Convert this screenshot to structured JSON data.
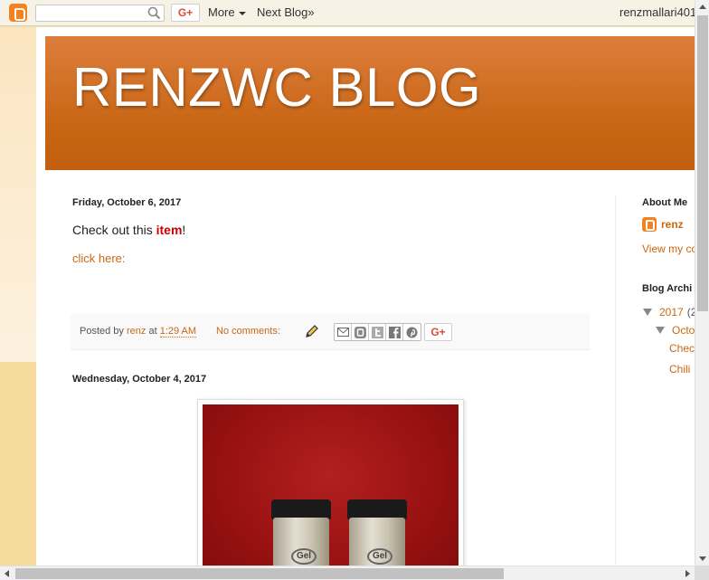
{
  "navbar": {
    "search_placeholder": "",
    "gplus_label": "G+",
    "more_label": "More",
    "next_blog_label": "Next Blog»",
    "user_email": "renzmallari401"
  },
  "header": {
    "title": "RENZWC BLOG"
  },
  "posts": [
    {
      "date": "Friday, October 6, 2017",
      "body_prefix": "Check out this ",
      "link_text": "item",
      "body_suffix": "!",
      "click_here": "click here:",
      "footer": {
        "posted_by": "Posted by",
        "author": "renz",
        "at": "at",
        "time": "1:29 AM",
        "comments": "No comments:",
        "gplus_label": "G+"
      }
    },
    {
      "date": "Wednesday, October 4, 2017",
      "jar_label_1": "Gel",
      "jar_label_2": "Gel"
    }
  ],
  "sidebar": {
    "about_heading": "About Me",
    "author_name": "renz",
    "view_profile": "View my co",
    "archive_heading": "Blog Archi",
    "archive_year": "2017",
    "archive_year_count": "(2",
    "archive_month": "Octo",
    "archive_posts": [
      "Chec",
      "Chili"
    ]
  },
  "colors": {
    "accent": "#cc6611",
    "header_bg": "#c76512",
    "page_bg": "#f6e1ad"
  }
}
